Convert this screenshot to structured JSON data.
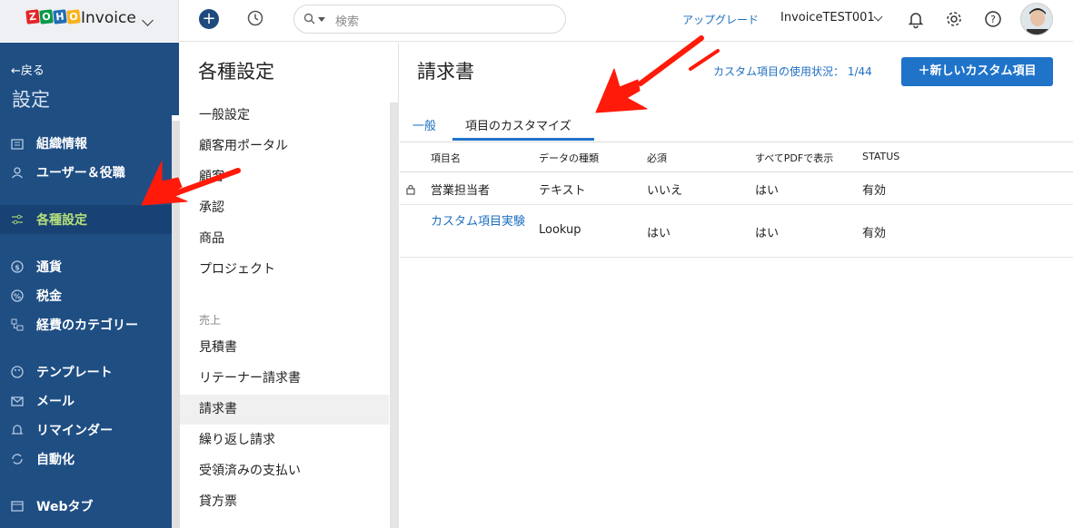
{
  "app": {
    "brand_letters": [
      "Z",
      "O",
      "H",
      "O"
    ],
    "brand_colors": [
      "#e42527",
      "#089949",
      "#226db4",
      "#f9b21d"
    ],
    "name": "Invoice"
  },
  "topbar": {
    "search_placeholder": "検索",
    "upgrade_label": "アップグレード",
    "org_name": "InvoiceTEST001",
    "icons": [
      "plus-icon",
      "history-icon",
      "bell-icon",
      "gear-icon",
      "help-icon"
    ]
  },
  "sidebar": {
    "back_label": "←戻る",
    "title": "設定",
    "items": [
      {
        "label": "組織情報",
        "icon": "building-icon"
      },
      {
        "label": "ユーザー＆役職",
        "icon": "users-icon"
      },
      {
        "label": "各種設定",
        "icon": "sliders-icon",
        "active": true
      },
      {
        "label": "通貨",
        "icon": "currency-icon"
      },
      {
        "label": "税金",
        "icon": "tax-icon"
      },
      {
        "label": "経費のカテゴリー",
        "icon": "category-icon"
      },
      {
        "label": "テンプレート",
        "icon": "palette-icon"
      },
      {
        "label": "メール",
        "icon": "mail-icon"
      },
      {
        "label": "リマインダー",
        "icon": "bell-icon"
      },
      {
        "label": "自動化",
        "icon": "automation-icon"
      },
      {
        "label": "Webタブ",
        "icon": "webtab-icon"
      }
    ]
  },
  "settings_panel": {
    "title": "各種設定",
    "items": [
      "一般設定",
      "顧客用ポータル",
      "顧客",
      "承認",
      "商品",
      "プロジェクト"
    ],
    "section_label": "売上",
    "sales_items": [
      "見積書",
      "リテーナー請求書",
      "請求書",
      "繰り返し請求",
      "受領済みの支払い",
      "貸方票"
    ],
    "active_item": "請求書"
  },
  "main": {
    "title": "請求書",
    "usage_text": "カスタム項目の使用状況： 1/44",
    "new_button_label": "＋新しいカスタム項目",
    "tabs": [
      "一般",
      "項目のカスタマイズ"
    ],
    "active_tab": "項目のカスタマイズ",
    "columns": [
      "項目名",
      "データの種類",
      "必須",
      "すべてPDFで表示",
      "STATUS"
    ],
    "rows": [
      {
        "name": "営業担当者",
        "type": "テキスト",
        "required": "いいえ",
        "pdf": "はい",
        "status": "有効",
        "locked": true
      },
      {
        "name": "カスタム項目実験",
        "type": "Lookup",
        "required": "はい",
        "pdf": "はい",
        "status": "有効",
        "locked": false
      }
    ]
  },
  "colors": {
    "sidebar": "#1f4e83",
    "accent": "#1f73c9",
    "active_text": "#b6e07b",
    "annotation_arrow": "#ff1a0a"
  }
}
